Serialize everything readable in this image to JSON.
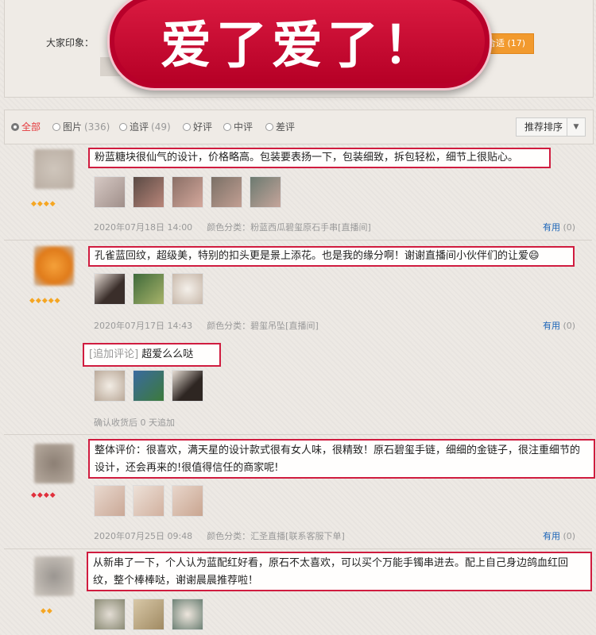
{
  "impression": {
    "label": "大家印象：",
    "tag": "寸合适 (17)"
  },
  "banner": {
    "text": "爱了爱了！"
  },
  "filters": [
    {
      "label": "全部",
      "count": ""
    },
    {
      "label": "图片",
      "count": "(336)"
    },
    {
      "label": "追评",
      "count": "(49)"
    },
    {
      "label": "好评",
      "count": ""
    },
    {
      "label": "中评",
      "count": ""
    },
    {
      "label": "差评",
      "count": ""
    }
  ],
  "sort": {
    "label": "推荐排序",
    "arrow": "▼"
  },
  "reviews": [
    {
      "text": "粉蓝糖块很仙气的设计，价格略高。包装要表扬一下，包装细致，拆包轻松，细节上很贴心。",
      "date": "2020年07月18日 14:00",
      "variant": "颜色分类：粉蓝西瓜碧玺原石手串[直播间]",
      "helpful": "有用",
      "helpful_count": "(0)",
      "stars": "◆◆◆◆",
      "star_color": "#f5a623"
    },
    {
      "text": "孔雀蓝回纹，超级美，特别的扣头更是景上添花。也是我的缘分啊！谢谢直播间小伙伴们的让爱😄",
      "date": "2020年07月17日 14:43",
      "variant": "颜色分类：碧玺吊坠[直播间]",
      "helpful": "有用",
      "helpful_count": "(0)",
      "stars": "◆◆◆◆◆",
      "star_color": "#f5a623",
      "append_label": "[追加评论]",
      "append_text": "超爱么么哒",
      "append_meta": "确认收货后 0 天追加"
    },
    {
      "text": "整体评价：很喜欢，满天星的设计款式很有女人味，很精致！原石碧玺手链，细细的金链子，很注重细节的设计，还会再来的!很值得信任的商家呢!",
      "date": "2020年07月25日 09:48",
      "variant": "颜色分类：汇圣直播[联系客服下单]",
      "helpful": "有用",
      "helpful_count": "(0)",
      "stars": "◆◆◆◆",
      "star_color": "#e0303c"
    },
    {
      "text": "从新串了一下，个人认为蓝配红好看，原石不太喜欢，可以买个万能手镯串进去。配上自己身边鸽血红回纹，整个棒棒哒，谢谢晨晨推荐啦！",
      "stars": "◆◆",
      "star_color": "#f5a623"
    }
  ],
  "colors": {
    "accent_border": "#d01c3f",
    "banner_red": "#c8102e",
    "link": "#1a64b8"
  }
}
